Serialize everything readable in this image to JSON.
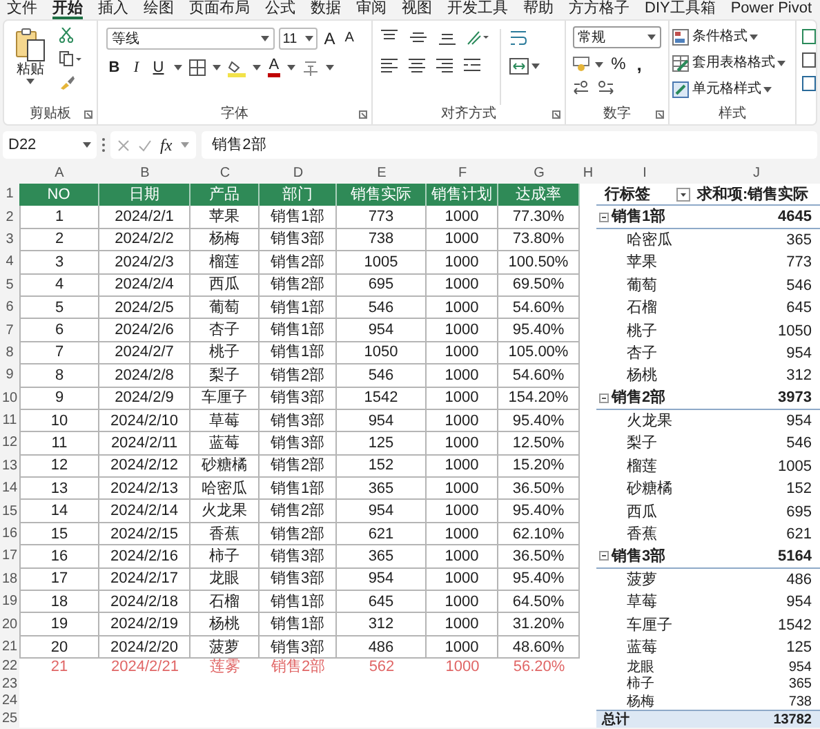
{
  "ribbon_tabs": [
    {
      "label": "文件",
      "selected": false
    },
    {
      "label": "开始",
      "selected": true
    },
    {
      "label": "插入",
      "selected": false
    },
    {
      "label": "绘图",
      "selected": false
    },
    {
      "label": "页面布局",
      "selected": false
    },
    {
      "label": "公式",
      "selected": false
    },
    {
      "label": "数据",
      "selected": false
    },
    {
      "label": "审阅",
      "selected": false
    },
    {
      "label": "视图",
      "selected": false
    },
    {
      "label": "开发工具",
      "selected": false
    },
    {
      "label": "帮助",
      "selected": false
    },
    {
      "label": "方方格子",
      "selected": false
    },
    {
      "label": "DIY工具箱",
      "selected": false
    },
    {
      "label": "Power Pivot",
      "selected": false
    }
  ],
  "ribbon": {
    "clipboard": {
      "label": "剪贴板",
      "paste": "粘贴"
    },
    "font": {
      "label": "字体",
      "font_name": "等线",
      "font_size": "11",
      "grow": "A",
      "shrink": "A",
      "bold": "B",
      "italic": "I",
      "underline": "U",
      "font_color": "A"
    },
    "alignment": {
      "label": "对齐方式"
    },
    "number": {
      "label": "数字",
      "format": "常规",
      "percent": "%",
      "comma": ","
    },
    "styles": {
      "label": "样式",
      "commands": [
        "条件格式",
        "套用表格格式",
        "单元格样式"
      ]
    }
  },
  "formula_bar": {
    "name_box": "D22",
    "function_label": "fx",
    "formula": "销售2部"
  },
  "sheet": {
    "column_letters": [
      "A",
      "B",
      "C",
      "D",
      "E",
      "F",
      "G",
      "H",
      "I",
      "J"
    ],
    "row_numbers": [
      "1",
      "2",
      "3",
      "4",
      "5",
      "6",
      "7",
      "8",
      "9",
      "10",
      "11",
      "12",
      "13",
      "14",
      "15",
      "16",
      "17",
      "18",
      "19",
      "20",
      "21",
      "22",
      "23",
      "24",
      "25"
    ],
    "table": {
      "columns": [
        "NO",
        "日期",
        "产品",
        "部门",
        "销售实际",
        "销售计划",
        "达成率"
      ],
      "rows": [
        {
          "cells": [
            "1",
            "2024/2/1",
            "苹果",
            "销售1部",
            "773",
            "1000",
            "77.30%"
          ],
          "flagged": false
        },
        {
          "cells": [
            "2",
            "2024/2/2",
            "杨梅",
            "销售3部",
            "738",
            "1000",
            "73.80%"
          ],
          "flagged": false
        },
        {
          "cells": [
            "3",
            "2024/2/3",
            "榴莲",
            "销售2部",
            "1005",
            "1000",
            "100.50%"
          ],
          "flagged": false
        },
        {
          "cells": [
            "4",
            "2024/2/4",
            "西瓜",
            "销售2部",
            "695",
            "1000",
            "69.50%"
          ],
          "flagged": false
        },
        {
          "cells": [
            "5",
            "2024/2/5",
            "葡萄",
            "销售1部",
            "546",
            "1000",
            "54.60%"
          ],
          "flagged": false
        },
        {
          "cells": [
            "6",
            "2024/2/6",
            "杏子",
            "销售1部",
            "954",
            "1000",
            "95.40%"
          ],
          "flagged": false
        },
        {
          "cells": [
            "7",
            "2024/2/7",
            "桃子",
            "销售1部",
            "1050",
            "1000",
            "105.00%"
          ],
          "flagged": false
        },
        {
          "cells": [
            "8",
            "2024/2/8",
            "梨子",
            "销售2部",
            "546",
            "1000",
            "54.60%"
          ],
          "flagged": false
        },
        {
          "cells": [
            "9",
            "2024/2/9",
            "车厘子",
            "销售3部",
            "1542",
            "1000",
            "154.20%"
          ],
          "flagged": false
        },
        {
          "cells": [
            "10",
            "2024/2/10",
            "草莓",
            "销售3部",
            "954",
            "1000",
            "95.40%"
          ],
          "flagged": false
        },
        {
          "cells": [
            "11",
            "2024/2/11",
            "蓝莓",
            "销售3部",
            "125",
            "1000",
            "12.50%"
          ],
          "flagged": false
        },
        {
          "cells": [
            "12",
            "2024/2/12",
            "砂糖橘",
            "销售2部",
            "152",
            "1000",
            "15.20%"
          ],
          "flagged": false
        },
        {
          "cells": [
            "13",
            "2024/2/13",
            "哈密瓜",
            "销售1部",
            "365",
            "1000",
            "36.50%"
          ],
          "flagged": false
        },
        {
          "cells": [
            "14",
            "2024/2/14",
            "火龙果",
            "销售2部",
            "954",
            "1000",
            "95.40%"
          ],
          "flagged": false
        },
        {
          "cells": [
            "15",
            "2024/2/15",
            "香蕉",
            "销售2部",
            "621",
            "1000",
            "62.10%"
          ],
          "flagged": false
        },
        {
          "cells": [
            "16",
            "2024/2/16",
            "柿子",
            "销售3部",
            "365",
            "1000",
            "36.50%"
          ],
          "flagged": false
        },
        {
          "cells": [
            "17",
            "2024/2/17",
            "龙眼",
            "销售3部",
            "954",
            "1000",
            "95.40%"
          ],
          "flagged": false
        },
        {
          "cells": [
            "18",
            "2024/2/18",
            "石榴",
            "销售1部",
            "645",
            "1000",
            "64.50%"
          ],
          "flagged": false
        },
        {
          "cells": [
            "19",
            "2024/2/19",
            "杨桃",
            "销售1部",
            "312",
            "1000",
            "31.20%"
          ],
          "flagged": false
        },
        {
          "cells": [
            "20",
            "2024/2/20",
            "菠萝",
            "销售3部",
            "486",
            "1000",
            "48.60%"
          ],
          "flagged": false
        },
        {
          "cells": [
            "21",
            "2024/2/21",
            "莲雾",
            "销售2部",
            "562",
            "1000",
            "56.20%"
          ],
          "flagged": true
        }
      ]
    },
    "pivot": {
      "header": [
        "行标签",
        "求和项:销售实际"
      ],
      "groups": [
        {
          "label": "销售1部",
          "total": "4645",
          "expanded": true,
          "children": [
            {
              "label": "哈密瓜",
              "value": "365"
            },
            {
              "label": "苹果",
              "value": "773"
            },
            {
              "label": "葡萄",
              "value": "546"
            },
            {
              "label": "石榴",
              "value": "645"
            },
            {
              "label": "桃子",
              "value": "1050"
            },
            {
              "label": "杏子",
              "value": "954"
            },
            {
              "label": "杨桃",
              "value": "312"
            }
          ]
        },
        {
          "label": "销售2部",
          "total": "3973",
          "expanded": true,
          "children": [
            {
              "label": "火龙果",
              "value": "954"
            },
            {
              "label": "梨子",
              "value": "546"
            },
            {
              "label": "榴莲",
              "value": "1005"
            },
            {
              "label": "砂糖橘",
              "value": "152"
            },
            {
              "label": "西瓜",
              "value": "695"
            },
            {
              "label": "香蕉",
              "value": "621"
            }
          ]
        },
        {
          "label": "销售3部",
          "total": "5164",
          "expanded": true,
          "children": [
            {
              "label": "菠萝",
              "value": "486"
            },
            {
              "label": "草莓",
              "value": "954"
            },
            {
              "label": "车厘子",
              "value": "1542"
            },
            {
              "label": "蓝莓",
              "value": "125"
            },
            {
              "label": "龙眼",
              "value": "954"
            },
            {
              "label": "柿子",
              "value": "365"
            },
            {
              "label": "杨梅",
              "value": "738"
            }
          ]
        }
      ],
      "grand_total": {
        "label": "总计",
        "value": "13782"
      }
    }
  }
}
